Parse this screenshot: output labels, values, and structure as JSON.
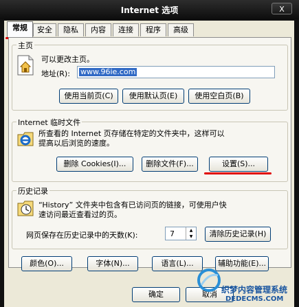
{
  "window": {
    "title": "Internet 选项",
    "close_glyph": "X"
  },
  "tabs": [
    "常规",
    "安全",
    "隐私",
    "内容",
    "连接",
    "程序",
    "高级"
  ],
  "home": {
    "legend": "主页",
    "desc": "可以更改主页。",
    "address_label": "地址(R):",
    "address_value": "www.96ie.com",
    "buttons": [
      "使用当前页(C)",
      "使用默认页(E)",
      "使用空白页(B)"
    ]
  },
  "temp_files": {
    "legend": "Internet 临时文件",
    "desc_line1": "所查看的 Internet 页存储在特定的文件夹中，这样可以",
    "desc_line2": "提高以后浏览的速度。",
    "buttons": [
      "删除 Cookies(I)...",
      "删除文件(F)...",
      "设置(S)..."
    ]
  },
  "history": {
    "legend": "历史记录",
    "desc_line1": "“History” 文件夹中包含有已访问页的链接，可使用户快",
    "desc_line2": "速访问最近查看过的页。",
    "days_label": "网页保存在历史记录中的天数(K):",
    "days_value": "7",
    "clear_button": "清除历史记录(H)"
  },
  "bottom_buttons": [
    "颜色(O)...",
    "字体(N)...",
    "语言(L)...",
    "辅助功能(E)..."
  ],
  "dialog_buttons": [
    "确定",
    "取消"
  ],
  "watermark": {
    "line1": "织梦内容管理系统",
    "line2": "DEDECMS.COM"
  }
}
